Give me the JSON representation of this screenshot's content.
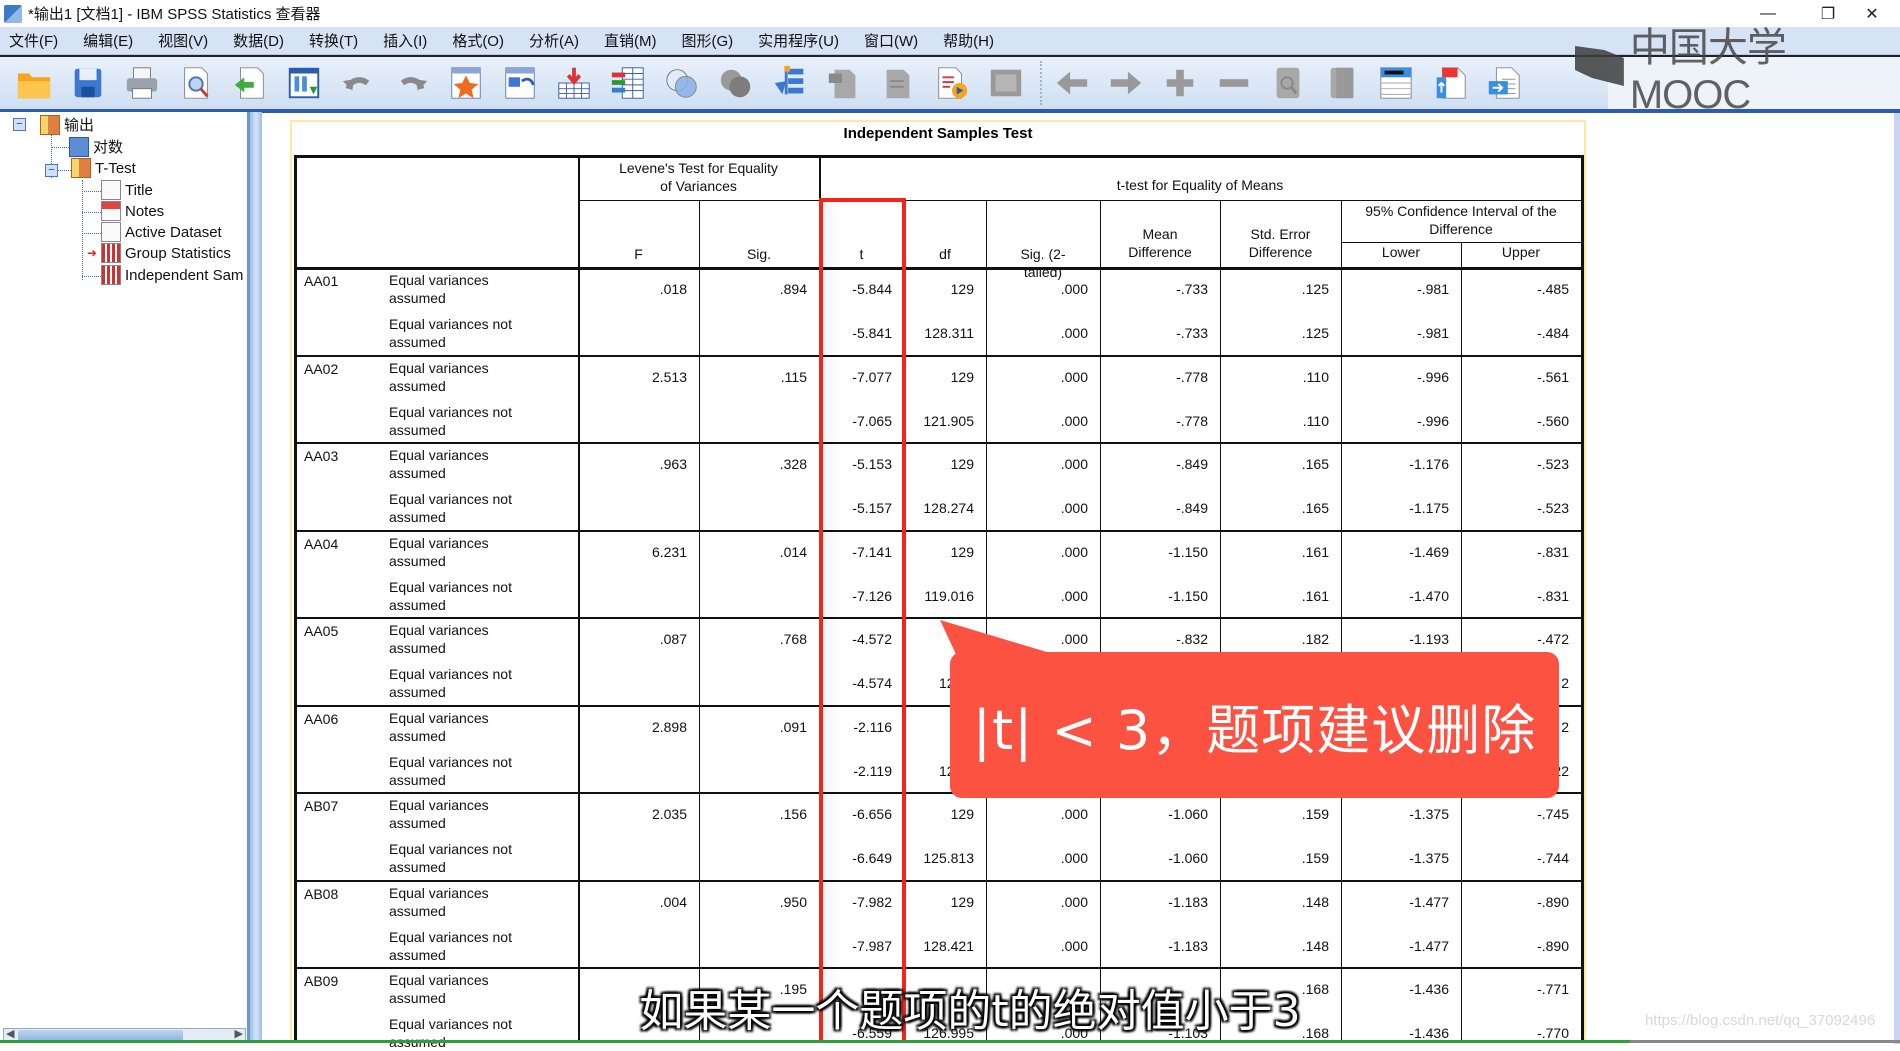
{
  "window": {
    "title": "*输出1 [文档1] - IBM SPSS Statistics 查看器",
    "controls": {
      "minimize": "—",
      "maximize": "❐",
      "close": "✕"
    }
  },
  "menu": [
    "文件(F)",
    "编辑(E)",
    "视图(V)",
    "数据(D)",
    "转换(T)",
    "插入(I)",
    "格式(O)",
    "分析(A)",
    "直销(M)",
    "图形(G)",
    "实用程序(U)",
    "窗口(W)",
    "帮助(H)"
  ],
  "toolbar": {
    "icons": [
      "open-folder-icon",
      "save-icon",
      "print-icon",
      "print-preview-icon",
      "export-icon",
      "recall-dialog-icon",
      "undo-icon",
      "redo-icon",
      "goto-case-icon",
      "goto-variable-icon",
      "insert-cases-icon",
      "variables-icon",
      "venn-icon",
      "circles-icon",
      "designate-window-icon",
      "promote-icon",
      "demote-icon",
      "insert-output-icon",
      "frame-icon",
      "back-icon",
      "forward-icon",
      "expand-icon",
      "collapse-icon",
      "show-icon",
      "hide-icon",
      "insert-heading-icon",
      "insert-title-icon",
      "insert-text-icon"
    ]
  },
  "watermark_logo": "中国大学MOOC",
  "outline": {
    "root": "输出",
    "log": "对数",
    "group": "T-Test",
    "children": [
      "Title",
      "Notes",
      "Active Dataset",
      "Group Statistics",
      "Independent Sam"
    ]
  },
  "table": {
    "title": "Independent Samples Test",
    "header": {
      "levene": "Levene's Test for Equality of Variances",
      "ttest": "t-test for Equality of Means",
      "ci": "95% Confidence Interval of the Difference",
      "cols": [
        "F",
        "Sig.",
        "t",
        "df",
        "Sig. (2-tailed)",
        "Mean Difference",
        "Std. Error Difference",
        "Lower",
        "Upper"
      ]
    },
    "row_labels": {
      "assumed": "Equal variances assumed",
      "not_assumed": "Equal variances not assumed"
    },
    "items": [
      {
        "name": "AA01",
        "rows": [
          [
            ".018",
            ".894",
            "-5.844",
            "129",
            ".000",
            "-.733",
            ".125",
            "-.981",
            "-.485"
          ],
          [
            "",
            "",
            "-5.841",
            "128.311",
            ".000",
            "-.733",
            ".125",
            "-.981",
            "-.484"
          ]
        ]
      },
      {
        "name": "AA02",
        "rows": [
          [
            "2.513",
            ".115",
            "-7.077",
            "129",
            ".000",
            "-.778",
            ".110",
            "-.996",
            "-.561"
          ],
          [
            "",
            "",
            "-7.065",
            "121.905",
            ".000",
            "-.778",
            ".110",
            "-.996",
            "-.560"
          ]
        ]
      },
      {
        "name": "AA03",
        "rows": [
          [
            ".963",
            ".328",
            "-5.153",
            "129",
            ".000",
            "-.849",
            ".165",
            "-1.176",
            "-.523"
          ],
          [
            "",
            "",
            "-5.157",
            "128.274",
            ".000",
            "-.849",
            ".165",
            "-1.175",
            "-.523"
          ]
        ]
      },
      {
        "name": "AA04",
        "rows": [
          [
            "6.231",
            ".014",
            "-7.141",
            "129",
            ".000",
            "-1.150",
            ".161",
            "-1.469",
            "-.831"
          ],
          [
            "",
            "",
            "-7.126",
            "119.016",
            ".000",
            "-1.150",
            ".161",
            "-1.470",
            "-.831"
          ]
        ]
      },
      {
        "name": "AA05",
        "rows": [
          [
            ".087",
            ".768",
            "-4.572",
            "129",
            ".000",
            "-.832",
            ".182",
            "-1.193",
            "-.472"
          ],
          [
            "",
            "",
            "-4.574",
            "128.8",
            "",
            "",
            "",
            "",
            "2"
          ]
        ]
      },
      {
        "name": "AA06",
        "rows": [
          [
            "2.898",
            ".091",
            "-2.116",
            "1",
            "",
            "",
            "",
            "",
            "2"
          ],
          [
            "",
            "",
            "-2.119",
            "126.4",
            "",
            "",
            "",
            "",
            "22"
          ]
        ]
      },
      {
        "name": "AB07",
        "rows": [
          [
            "2.035",
            ".156",
            "-6.656",
            "129",
            ".000",
            "-1.060",
            ".159",
            "-1.375",
            "-.745"
          ],
          [
            "",
            "",
            "-6.649",
            "125.813",
            ".000",
            "-1.060",
            ".159",
            "-1.375",
            "-.744"
          ]
        ]
      },
      {
        "name": "AB08",
        "rows": [
          [
            ".004",
            ".950",
            "-7.982",
            "129",
            ".000",
            "-1.183",
            ".148",
            "-1.477",
            "-.890"
          ],
          [
            "",
            "",
            "-7.987",
            "128.421",
            ".000",
            "-1.183",
            ".148",
            "-1.477",
            "-.890"
          ]
        ]
      },
      {
        "name": "AB09",
        "rows": [
          [
            "",
            ".195",
            "",
            "",
            "",
            "",
            ".168",
            "-1.436",
            "-.771"
          ],
          [
            "",
            "",
            "-6.559",
            "126.995",
            ".000",
            "-1.103",
            ".168",
            "-1.436",
            "-.770"
          ]
        ]
      }
    ]
  },
  "callout": {
    "text": "|t| < 3，题项建议删除",
    "color": "#fb5242"
  },
  "subtitle": "如果某一个题项的t的绝对值小于3",
  "watermark": "https://blog.csdn.net/qq_37092496",
  "colors": {
    "highlight_box": "#f1261b",
    "menu_bg": "#d5e3f5",
    "pivot_frame": "#ffe7a6"
  }
}
